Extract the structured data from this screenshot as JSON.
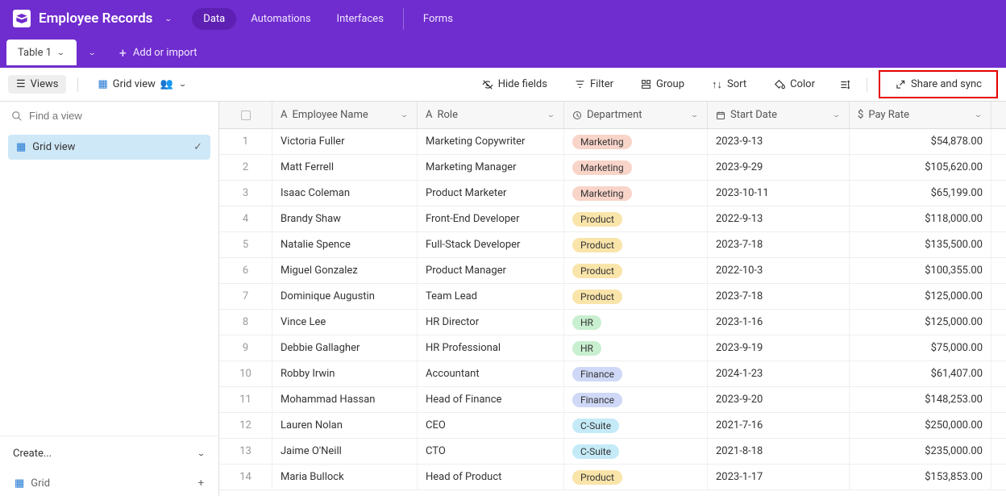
{
  "header": {
    "base_name": "Employee Records",
    "nav": [
      "Data",
      "Automations",
      "Interfaces",
      "Forms"
    ]
  },
  "tab_bar": {
    "table_tab": "Table 1",
    "add_or_import": "Add or import"
  },
  "toolbar": {
    "views": "Views",
    "grid_view": "Grid view",
    "hide_fields": "Hide fields",
    "filter": "Filter",
    "group": "Group",
    "sort": "Sort",
    "color": "Color",
    "share": "Share and sync"
  },
  "sidebar": {
    "search_placeholder": "Find a view",
    "grid_view": "Grid view",
    "create": "Create...",
    "grid": "Grid"
  },
  "columns": {
    "name": "Employee Name",
    "role": "Role",
    "dept": "Department",
    "date": "Start Date",
    "pay": "Pay Rate"
  },
  "rows": [
    {
      "n": "1",
      "name": "Victoria Fuller",
      "role": "Marketing Copywriter",
      "dept": "Marketing",
      "dept_class": "marketing",
      "date": "2023-9-13",
      "pay": "$54,878.00"
    },
    {
      "n": "2",
      "name": "Matt Ferrell",
      "role": "Marketing Manager",
      "dept": "Marketing",
      "dept_class": "marketing",
      "date": "2023-9-29",
      "pay": "$105,620.00"
    },
    {
      "n": "3",
      "name": "Isaac Coleman",
      "role": "Product Marketer",
      "dept": "Marketing",
      "dept_class": "marketing",
      "date": "2023-10-11",
      "pay": "$65,199.00"
    },
    {
      "n": "4",
      "name": "Brandy Shaw",
      "role": "Front-End Developer",
      "dept": "Product",
      "dept_class": "product",
      "date": "2022-9-13",
      "pay": "$118,000.00"
    },
    {
      "n": "5",
      "name": "Natalie Spence",
      "role": "Full-Stack Developer",
      "dept": "Product",
      "dept_class": "product",
      "date": "2023-7-18",
      "pay": "$135,500.00"
    },
    {
      "n": "6",
      "name": "Miguel Gonzalez",
      "role": "Product Manager",
      "dept": "Product",
      "dept_class": "product",
      "date": "2022-10-3",
      "pay": "$100,355.00"
    },
    {
      "n": "7",
      "name": "Dominique Augustin",
      "role": "Team Lead",
      "dept": "Product",
      "dept_class": "product",
      "date": "2023-7-18",
      "pay": "$125,000.00"
    },
    {
      "n": "8",
      "name": "Vince Lee",
      "role": "HR Director",
      "dept": "HR",
      "dept_class": "hr",
      "date": "2023-1-16",
      "pay": "$125,000.00"
    },
    {
      "n": "9",
      "name": "Debbie Gallagher",
      "role": "HR Professional",
      "dept": "HR",
      "dept_class": "hr",
      "date": "2023-9-19",
      "pay": "$75,000.00"
    },
    {
      "n": "10",
      "name": "Robby Irwin",
      "role": "Accountant",
      "dept": "Finance",
      "dept_class": "finance",
      "date": "2024-1-23",
      "pay": "$61,407.00"
    },
    {
      "n": "11",
      "name": "Mohammad Hassan",
      "role": "Head of Finance",
      "dept": "Finance",
      "dept_class": "finance",
      "date": "2023-9-20",
      "pay": "$148,253.00"
    },
    {
      "n": "12",
      "name": "Lauren Nolan",
      "role": "CEO",
      "dept": "C-Suite",
      "dept_class": "csuite",
      "date": "2021-7-16",
      "pay": "$250,000.00"
    },
    {
      "n": "13",
      "name": "Jaime O'Neill",
      "role": "CTO",
      "dept": "C-Suite",
      "dept_class": "csuite",
      "date": "2021-8-18",
      "pay": "$235,000.00"
    },
    {
      "n": "14",
      "name": "Maria Bullock",
      "role": "Head of Product",
      "dept": "Product",
      "dept_class": "product",
      "date": "2023-1-17",
      "pay": "$153,853.00"
    }
  ]
}
